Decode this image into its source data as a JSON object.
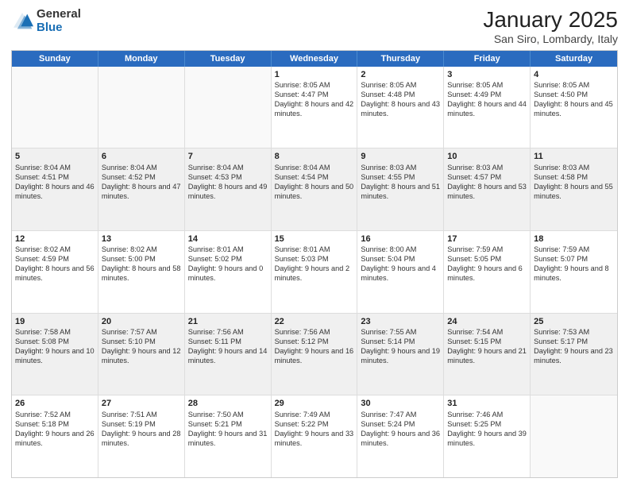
{
  "logo": {
    "general": "General",
    "blue": "Blue"
  },
  "title": "January 2025",
  "subtitle": "San Siro, Lombardy, Italy",
  "days_of_week": [
    "Sunday",
    "Monday",
    "Tuesday",
    "Wednesday",
    "Thursday",
    "Friday",
    "Saturday"
  ],
  "weeks": [
    [
      {
        "day": "",
        "empty": true
      },
      {
        "day": "",
        "empty": true
      },
      {
        "day": "",
        "empty": true
      },
      {
        "day": "1",
        "sunrise": "8:05 AM",
        "sunset": "4:47 PM",
        "daylight": "8 hours and 42 minutes."
      },
      {
        "day": "2",
        "sunrise": "8:05 AM",
        "sunset": "4:48 PM",
        "daylight": "8 hours and 43 minutes."
      },
      {
        "day": "3",
        "sunrise": "8:05 AM",
        "sunset": "4:49 PM",
        "daylight": "8 hours and 44 minutes."
      },
      {
        "day": "4",
        "sunrise": "8:05 AM",
        "sunset": "4:50 PM",
        "daylight": "8 hours and 45 minutes."
      }
    ],
    [
      {
        "day": "5",
        "sunrise": "8:04 AM",
        "sunset": "4:51 PM",
        "daylight": "8 hours and 46 minutes."
      },
      {
        "day": "6",
        "sunrise": "8:04 AM",
        "sunset": "4:52 PM",
        "daylight": "8 hours and 47 minutes."
      },
      {
        "day": "7",
        "sunrise": "8:04 AM",
        "sunset": "4:53 PM",
        "daylight": "8 hours and 49 minutes."
      },
      {
        "day": "8",
        "sunrise": "8:04 AM",
        "sunset": "4:54 PM",
        "daylight": "8 hours and 50 minutes."
      },
      {
        "day": "9",
        "sunrise": "8:03 AM",
        "sunset": "4:55 PM",
        "daylight": "8 hours and 51 minutes."
      },
      {
        "day": "10",
        "sunrise": "8:03 AM",
        "sunset": "4:57 PM",
        "daylight": "8 hours and 53 minutes."
      },
      {
        "day": "11",
        "sunrise": "8:03 AM",
        "sunset": "4:58 PM",
        "daylight": "8 hours and 55 minutes."
      }
    ],
    [
      {
        "day": "12",
        "sunrise": "8:02 AM",
        "sunset": "4:59 PM",
        "daylight": "8 hours and 56 minutes."
      },
      {
        "day": "13",
        "sunrise": "8:02 AM",
        "sunset": "5:00 PM",
        "daylight": "8 hours and 58 minutes."
      },
      {
        "day": "14",
        "sunrise": "8:01 AM",
        "sunset": "5:02 PM",
        "daylight": "9 hours and 0 minutes."
      },
      {
        "day": "15",
        "sunrise": "8:01 AM",
        "sunset": "5:03 PM",
        "daylight": "9 hours and 2 minutes."
      },
      {
        "day": "16",
        "sunrise": "8:00 AM",
        "sunset": "5:04 PM",
        "daylight": "9 hours and 4 minutes."
      },
      {
        "day": "17",
        "sunrise": "7:59 AM",
        "sunset": "5:05 PM",
        "daylight": "9 hours and 6 minutes."
      },
      {
        "day": "18",
        "sunrise": "7:59 AM",
        "sunset": "5:07 PM",
        "daylight": "9 hours and 8 minutes."
      }
    ],
    [
      {
        "day": "19",
        "sunrise": "7:58 AM",
        "sunset": "5:08 PM",
        "daylight": "9 hours and 10 minutes."
      },
      {
        "day": "20",
        "sunrise": "7:57 AM",
        "sunset": "5:10 PM",
        "daylight": "9 hours and 12 minutes."
      },
      {
        "day": "21",
        "sunrise": "7:56 AM",
        "sunset": "5:11 PM",
        "daylight": "9 hours and 14 minutes."
      },
      {
        "day": "22",
        "sunrise": "7:56 AM",
        "sunset": "5:12 PM",
        "daylight": "9 hours and 16 minutes."
      },
      {
        "day": "23",
        "sunrise": "7:55 AM",
        "sunset": "5:14 PM",
        "daylight": "9 hours and 19 minutes."
      },
      {
        "day": "24",
        "sunrise": "7:54 AM",
        "sunset": "5:15 PM",
        "daylight": "9 hours and 21 minutes."
      },
      {
        "day": "25",
        "sunrise": "7:53 AM",
        "sunset": "5:17 PM",
        "daylight": "9 hours and 23 minutes."
      }
    ],
    [
      {
        "day": "26",
        "sunrise": "7:52 AM",
        "sunset": "5:18 PM",
        "daylight": "9 hours and 26 minutes."
      },
      {
        "day": "27",
        "sunrise": "7:51 AM",
        "sunset": "5:19 PM",
        "daylight": "9 hours and 28 minutes."
      },
      {
        "day": "28",
        "sunrise": "7:50 AM",
        "sunset": "5:21 PM",
        "daylight": "9 hours and 31 minutes."
      },
      {
        "day": "29",
        "sunrise": "7:49 AM",
        "sunset": "5:22 PM",
        "daylight": "9 hours and 33 minutes."
      },
      {
        "day": "30",
        "sunrise": "7:47 AM",
        "sunset": "5:24 PM",
        "daylight": "9 hours and 36 minutes."
      },
      {
        "day": "31",
        "sunrise": "7:46 AM",
        "sunset": "5:25 PM",
        "daylight": "9 hours and 39 minutes."
      },
      {
        "day": "",
        "empty": true
      }
    ]
  ]
}
